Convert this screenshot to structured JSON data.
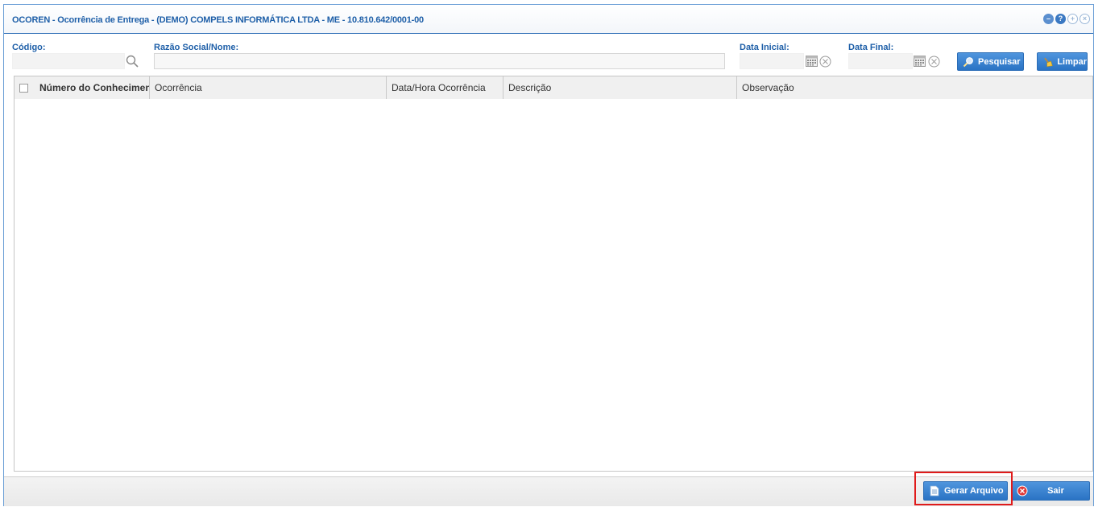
{
  "window": {
    "title": "OCOREN - Ocorrência de Entrega - (DEMO) COMPELS INFORMÁTICA LTDA - ME - 10.810.642/0001-00",
    "controls": [
      "minimize-icon",
      "help-icon",
      "maximize-icon",
      "close-icon"
    ]
  },
  "filters": {
    "codigo_label": "Código:",
    "codigo_value": "",
    "razao_label": "Razão Social/Nome:",
    "razao_value": "",
    "data_inicial_label": "Data Inicial:",
    "data_inicial_value": "",
    "data_final_label": "Data Final:",
    "data_final_value": "",
    "pesquisar_label": "Pesquisar",
    "limpar_label": "Limpar"
  },
  "grid": {
    "columns": [
      "Número do Conhecimento",
      "Ocorrência",
      "Data/Hora Ocorrência",
      "Descrição",
      "Observação"
    ],
    "rows": []
  },
  "footer": {
    "gerar_label": "Gerar Arquivo",
    "sair_label": "Sair"
  },
  "colors": {
    "accent": "#1e5fa8",
    "button": "#2a73c4",
    "highlight": "#e01b1b"
  }
}
